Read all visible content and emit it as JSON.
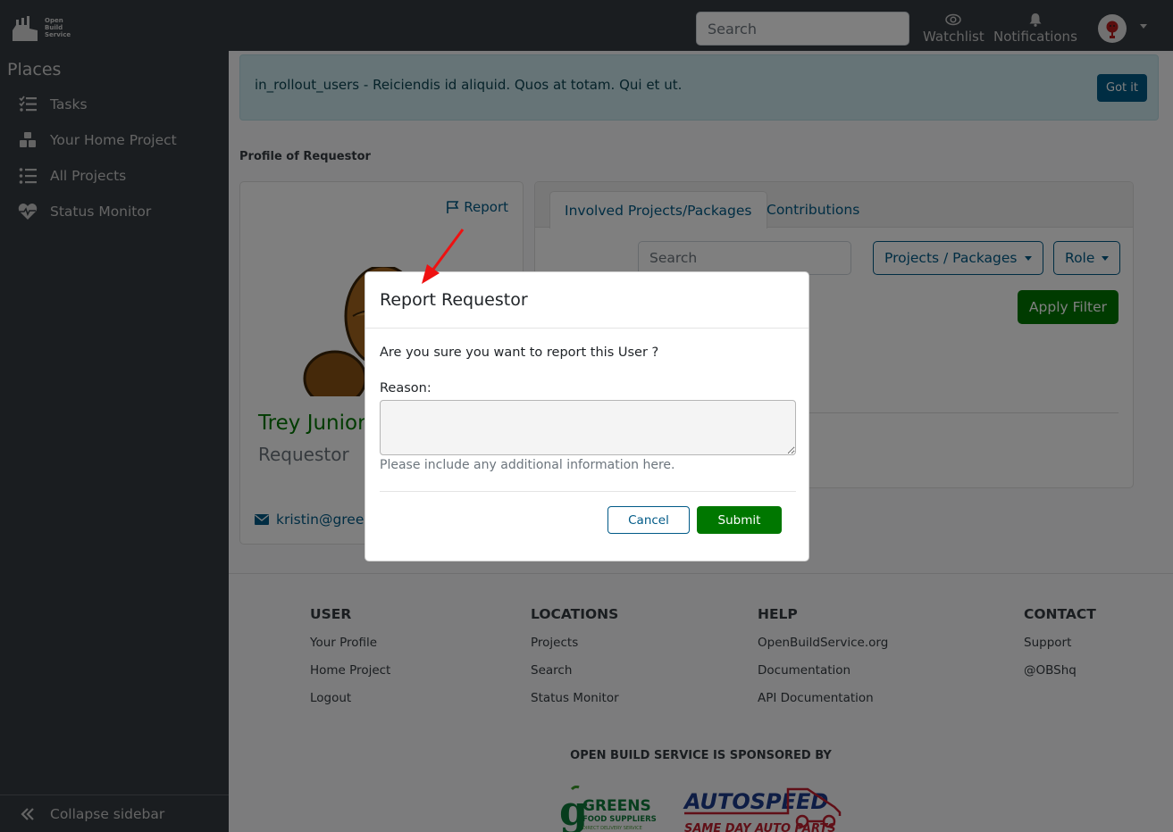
{
  "app": {
    "logo_lines": [
      "Open",
      "Build",
      "Service"
    ]
  },
  "topbar": {
    "search_placeholder": "Search",
    "watchlist_label": "Watchlist",
    "notifications_label": "Notifications"
  },
  "sidebar": {
    "heading": "Places",
    "items": [
      {
        "label": "Tasks",
        "icon": "tasks-icon"
      },
      {
        "label": "Your Home Project",
        "icon": "cubes-icon"
      },
      {
        "label": "All Projects",
        "icon": "list-icon"
      },
      {
        "label": "Status Monitor",
        "icon": "heartbeat-icon"
      }
    ],
    "collapse_label": "Collapse sidebar"
  },
  "alert": {
    "text": "in_rollout_users - Reiciendis id aliquid. Quos at totam. Qui et ut.",
    "button_label": "Got it"
  },
  "profile": {
    "heading": "Profile of Requestor",
    "report_label": "Report",
    "name": "Trey Junior",
    "role": "Requestor",
    "email": "kristin@green"
  },
  "involvement": {
    "tabs": [
      {
        "label": "Involved Projects/Packages",
        "active": true
      },
      {
        "label": "Contributions",
        "active": false
      }
    ],
    "search_placeholder": "Search",
    "type_filter_label": "Projects / Packages",
    "role_filter_label": "Role",
    "apply_label": "Apply Filter"
  },
  "footer": {
    "columns": [
      {
        "title": "USER",
        "links": [
          "Your Profile",
          "Home Project",
          "Logout"
        ]
      },
      {
        "title": "LOCATIONS",
        "links": [
          "Projects",
          "Search",
          "Status Monitor"
        ]
      },
      {
        "title": "HELP",
        "links": [
          "OpenBuildService.org",
          "Documentation",
          "API Documentation"
        ]
      },
      {
        "title": "CONTACT",
        "links": [
          "Support",
          "@OBShq"
        ]
      }
    ],
    "sponsor_title": "OPEN BUILD SERVICE IS SPONSORED BY",
    "sponsors": [
      {
        "name": "GREENS",
        "sub": "FOOD SUPPLIERS",
        "tagline": "DIRECT DELIVERY SERVICE"
      },
      {
        "name": "AUTOSPEED",
        "sub": "SAME DAY AUTO PARTS"
      }
    ]
  },
  "modal": {
    "title": "Report Requestor",
    "question": "Are you sure you want to report this User ?",
    "reason_label": "Reason:",
    "reason_value": "",
    "help_text": "Please include any additional information here.",
    "cancel_label": "Cancel",
    "submit_label": "Submit"
  },
  "colors": {
    "primary": "#005a87",
    "success": "#007700",
    "navbar": "#343a40",
    "annotation_arrow": "#ee1111"
  }
}
